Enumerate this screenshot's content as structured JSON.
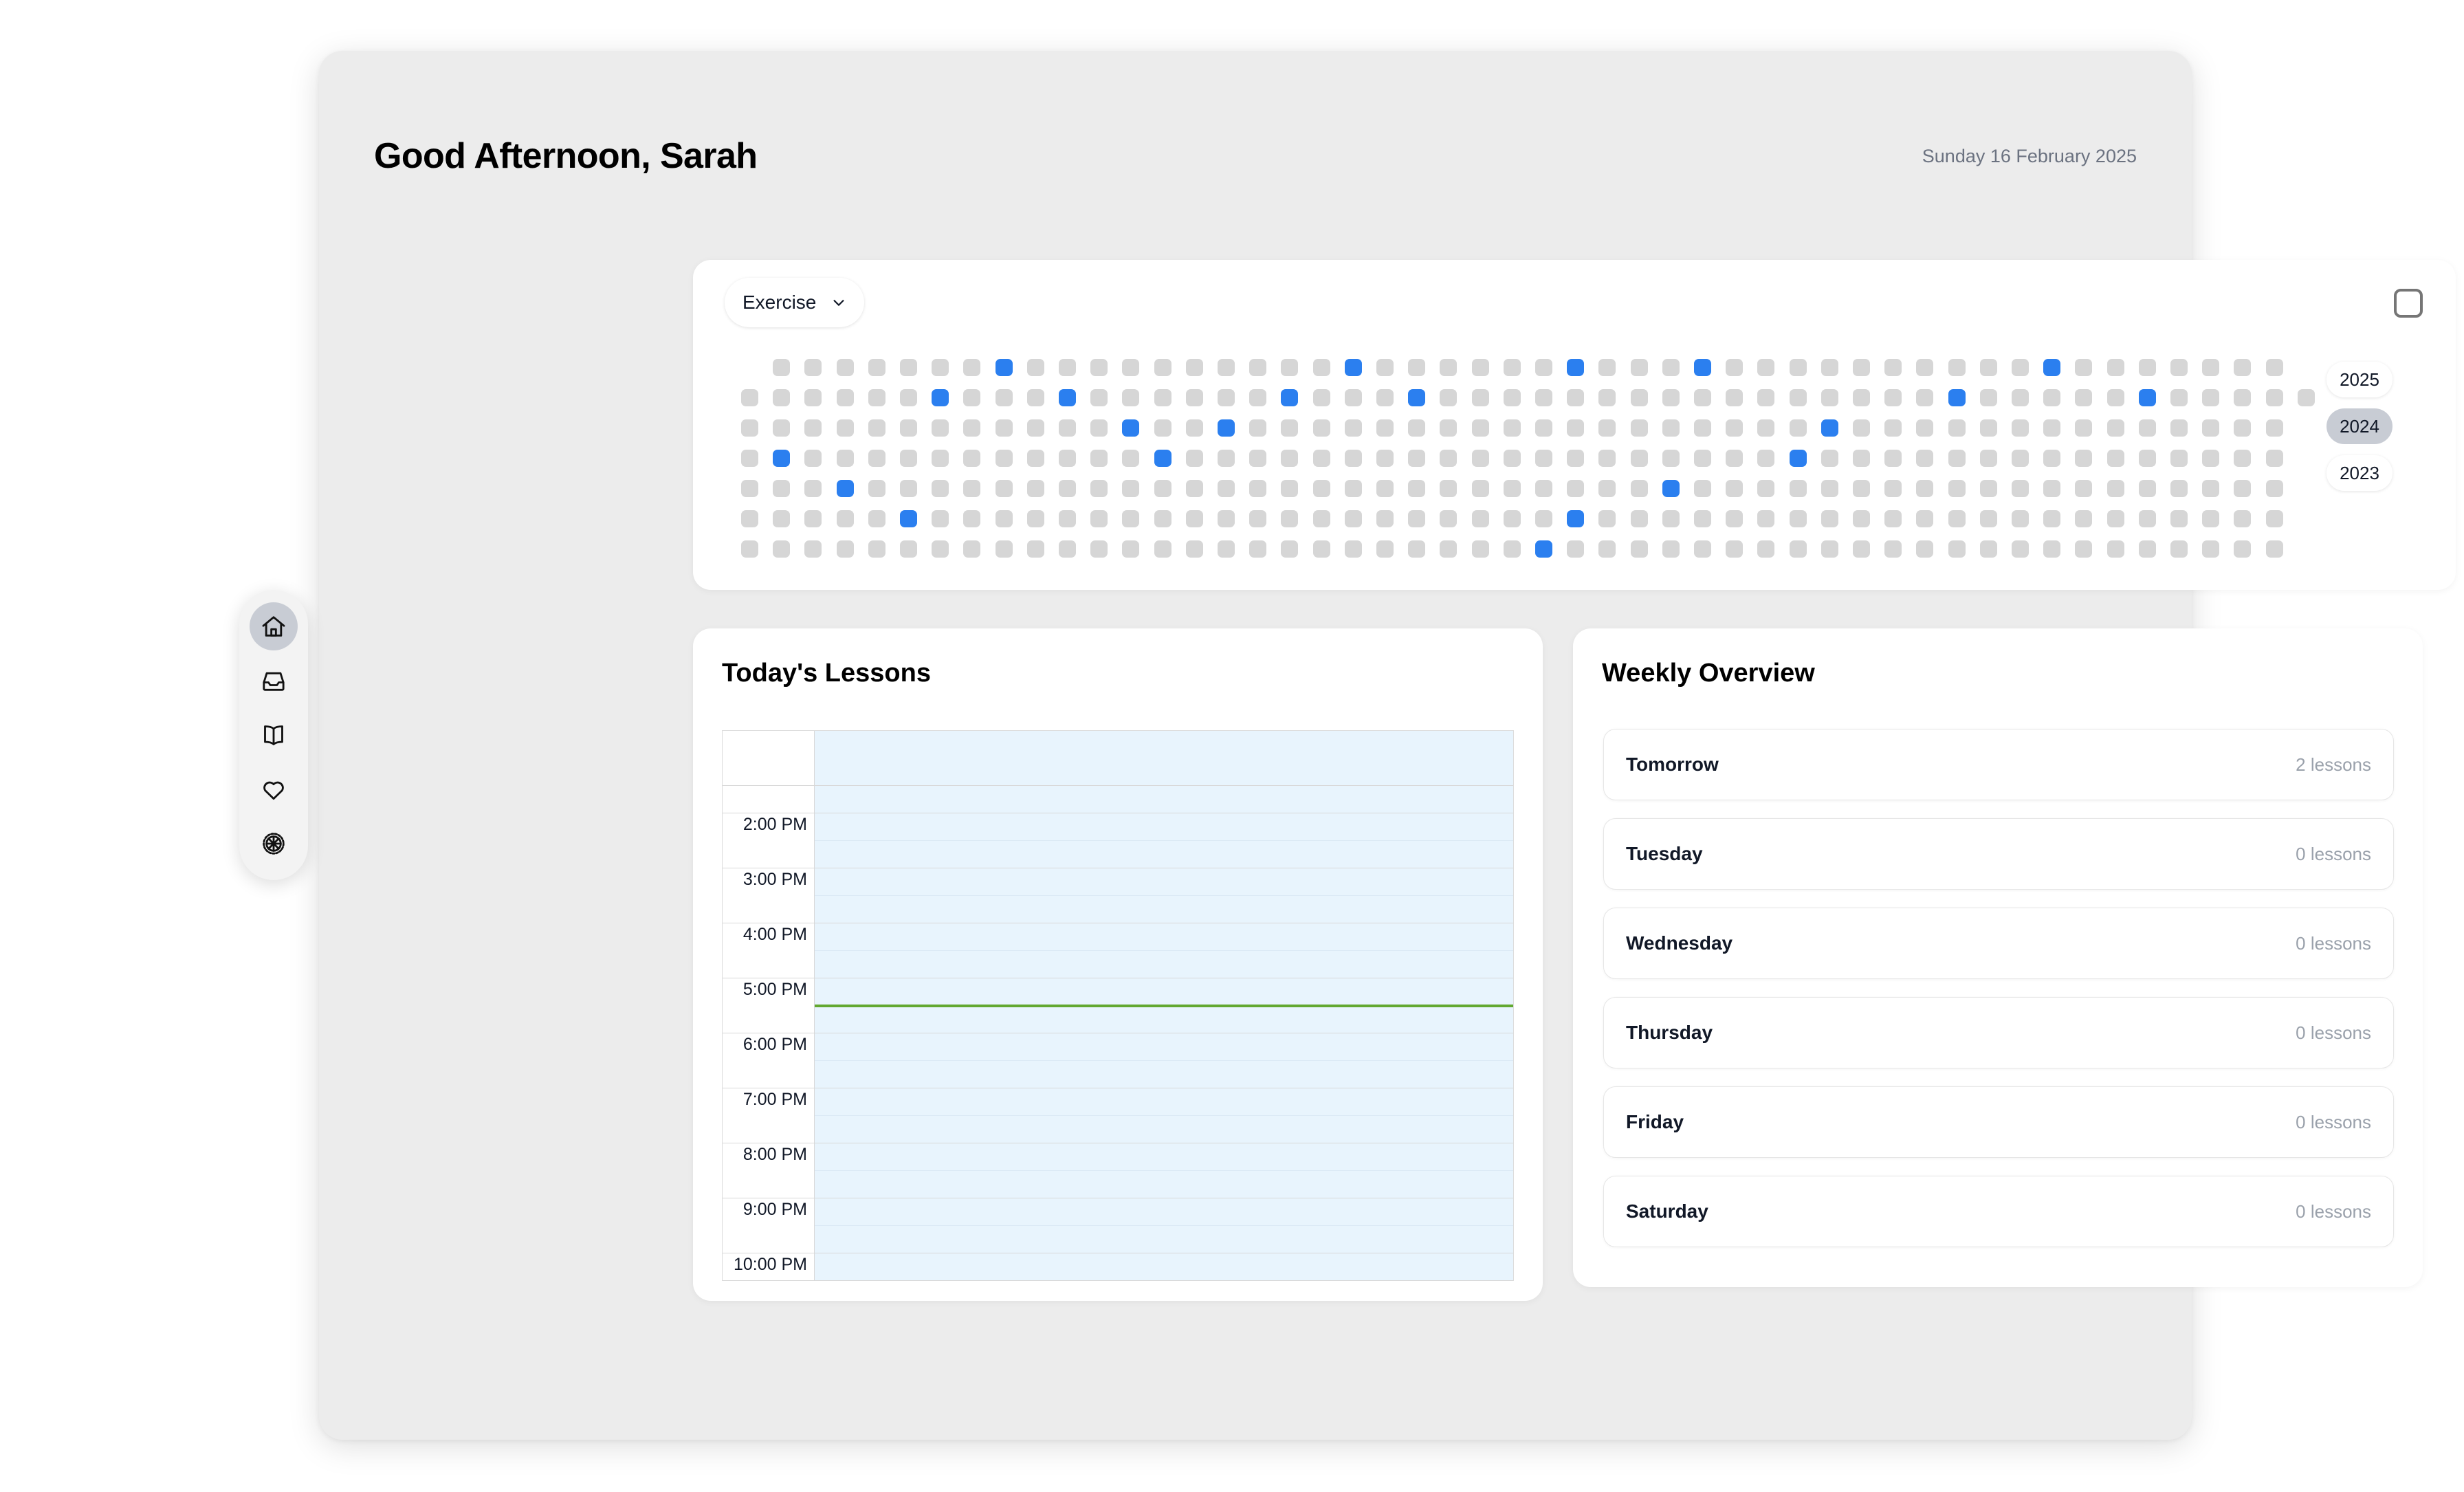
{
  "header": {
    "greeting": "Good Afternoon, Sarah",
    "date": "Sunday 16 February 2025"
  },
  "activity": {
    "category_label": "Exercise",
    "category_icon": "chevron-down-icon",
    "checkbox_checked": false,
    "years": [
      {
        "label": "2025",
        "active": false
      },
      {
        "label": "2024",
        "active": true
      },
      {
        "label": "2023",
        "active": false
      }
    ],
    "colors": {
      "empty": "#d6d6d6",
      "filled": "#2b7fef",
      "active_year": "#c8ccd4"
    },
    "heatmap": {
      "rows": 7,
      "columns": 49,
      "row_offsets": [
        1,
        0,
        0,
        0,
        0,
        0,
        0
      ],
      "row_lengths": [
        49,
        50,
        49,
        49,
        49,
        49,
        49
      ],
      "filled": [
        [
          8,
          19,
          26,
          30,
          41
        ],
        [
          6,
          10,
          17,
          21,
          38,
          44
        ],
        [
          12,
          15,
          34
        ],
        [
          1,
          13,
          33
        ],
        [
          3,
          29
        ],
        [
          5,
          26
        ],
        [
          25
        ]
      ]
    }
  },
  "lessons": {
    "title": "Today's Lessons",
    "current_time_color": "#62a830",
    "slots": [
      {
        "label": "",
        "type": "header"
      },
      {
        "label": "",
        "type": "half"
      },
      {
        "label": "2:00 PM",
        "type": "hour"
      },
      {
        "label": "3:00 PM",
        "type": "hour"
      },
      {
        "label": "4:00 PM",
        "type": "hour"
      },
      {
        "label": "5:00 PM",
        "type": "hour"
      },
      {
        "label": "6:00 PM",
        "type": "hour"
      },
      {
        "label": "7:00 PM",
        "type": "hour"
      },
      {
        "label": "8:00 PM",
        "type": "hour"
      },
      {
        "label": "9:00 PM",
        "type": "hour"
      },
      {
        "label": "10:00 PM",
        "type": "last"
      }
    ]
  },
  "weekly": {
    "title": "Weekly Overview",
    "days": [
      {
        "day": "Tomorrow",
        "count": "2 lessons"
      },
      {
        "day": "Tuesday",
        "count": "0 lessons"
      },
      {
        "day": "Wednesday",
        "count": "0 lessons"
      },
      {
        "day": "Thursday",
        "count": "0 lessons"
      },
      {
        "day": "Friday",
        "count": "0 lessons"
      },
      {
        "day": "Saturday",
        "count": "0 lessons"
      }
    ]
  },
  "sidebar": {
    "items": [
      {
        "icon": "home-icon",
        "name": "home",
        "active": true
      },
      {
        "icon": "inbox-icon",
        "name": "inbox",
        "active": false
      },
      {
        "icon": "book-icon",
        "name": "library",
        "active": false
      },
      {
        "icon": "heart-icon",
        "name": "favorites",
        "active": false
      },
      {
        "icon": "gear-icon",
        "name": "settings",
        "active": false
      }
    ]
  }
}
